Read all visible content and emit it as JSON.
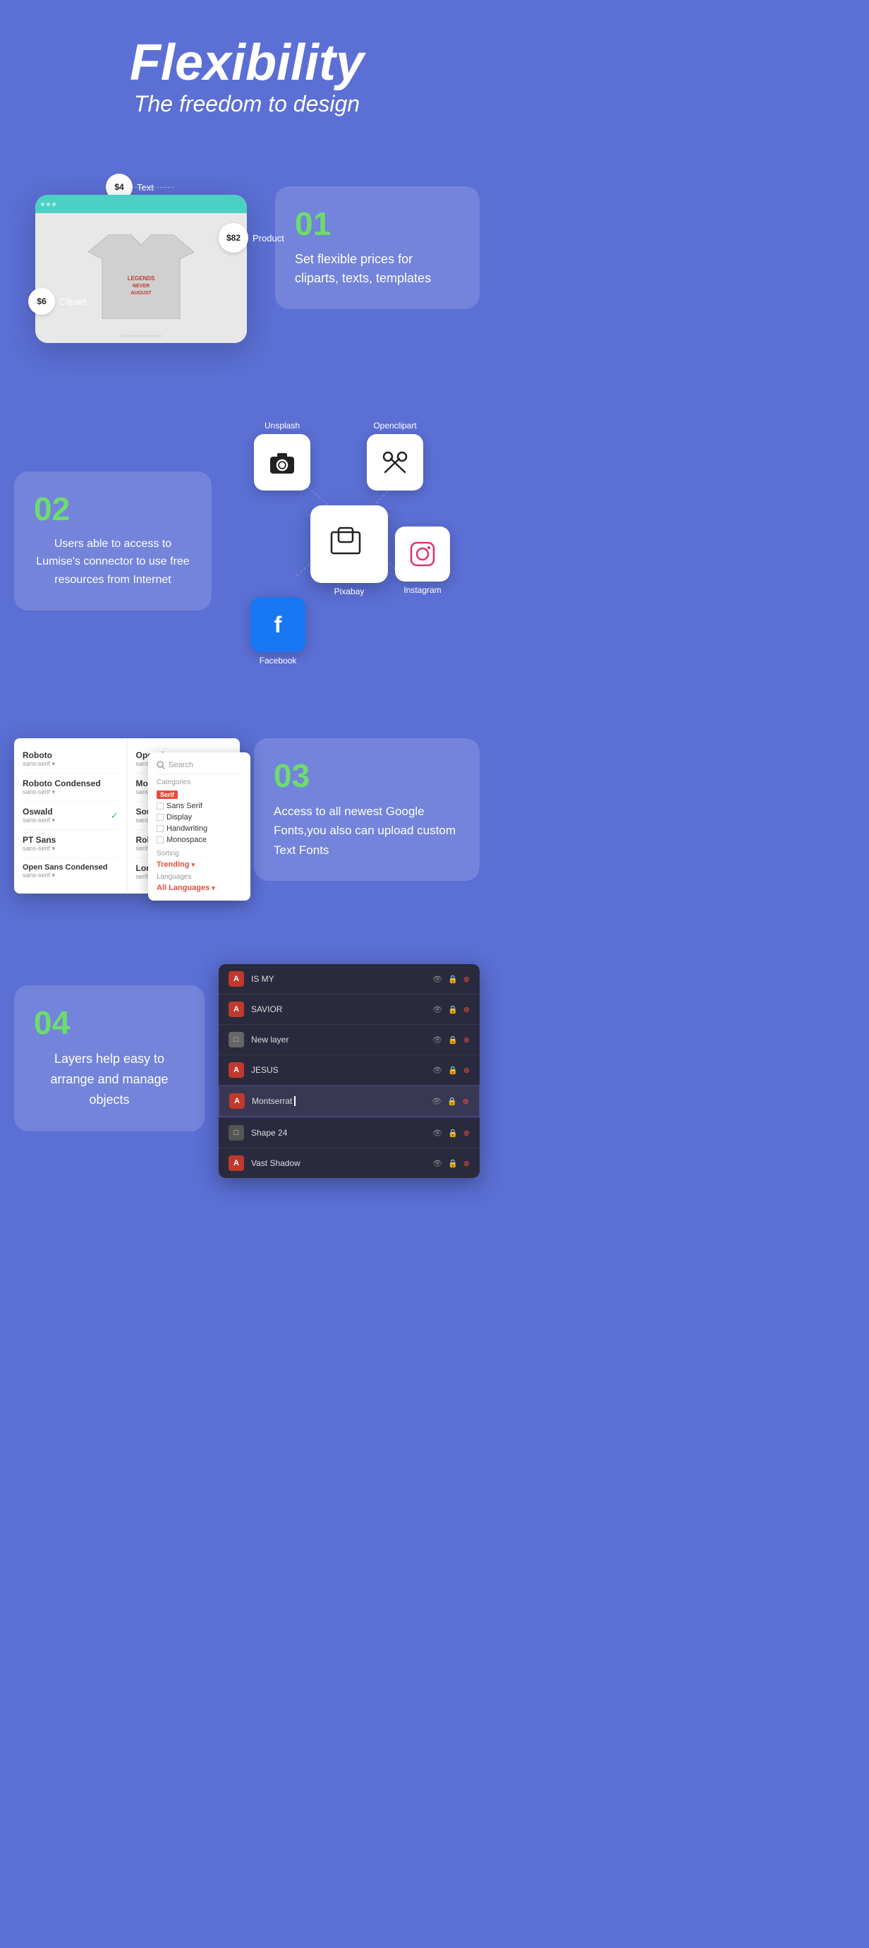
{
  "hero": {
    "title": "Flexibility",
    "subtitle": "The freedom to design"
  },
  "section1": {
    "number": "01",
    "description": "Set flexible prices for cliparts, texts, templates",
    "prices": {
      "text": "$4",
      "text_label": "Text",
      "product": "$82",
      "product_label": "Product",
      "clipart": "$6",
      "clipart_label": "Clipart"
    }
  },
  "section2": {
    "number": "02",
    "description": "Users able to access to Lumise's connector to use free resources from Internet",
    "connectors": [
      {
        "name": "Unsplash",
        "icon": "camera"
      },
      {
        "name": "Openclipart",
        "icon": "scissors"
      },
      {
        "name": "Pixabay",
        "icon": "photos"
      },
      {
        "name": "Instagram",
        "icon": "instagram"
      },
      {
        "name": "Facebook",
        "icon": "facebook"
      }
    ]
  },
  "section3": {
    "number": "03",
    "description": "Access to all newest Google Fonts,you also can upload custom Text Fonts",
    "fonts_left": [
      {
        "name": "Roboto",
        "meta": "sans-serif",
        "selected": false
      },
      {
        "name": "Roboto Condensed",
        "meta": "sans-serif",
        "selected": false
      },
      {
        "name": "Oswald",
        "meta": "sans-serif",
        "selected": true
      },
      {
        "name": "PT Sans",
        "meta": "sans-serif",
        "selected": false
      },
      {
        "name": "Open Sans Condensed",
        "meta": "sans-serif",
        "selected": false
      }
    ],
    "fonts_right": [
      {
        "name": "Open Sans",
        "meta": "sans-serif",
        "selected": true
      },
      {
        "name": "Montserrat",
        "meta": "sans-serif",
        "selected": false
      },
      {
        "name": "Source Sans",
        "meta": "sans-serif",
        "selected": false
      },
      {
        "name": "Roboto Slab",
        "meta": "serif",
        "selected": false
      },
      {
        "name": "Lora",
        "meta": "serif",
        "selected": false
      }
    ],
    "dropdown": {
      "search_placeholder": "Search",
      "categories_label": "Categories",
      "categories": [
        "Serif",
        "Sans Serif",
        "Display",
        "Handwriting",
        "Monospace"
      ],
      "sorting_label": "Sorting",
      "sorting_value": "Trending",
      "languages_label": "Languages",
      "languages_value": "All Languages"
    }
  },
  "section4": {
    "number": "04",
    "description": "Layers help easy to arrange and manage objects",
    "layers": [
      {
        "name": "IS MY",
        "icon": "text",
        "active": false
      },
      {
        "name": "SAVIOR",
        "icon": "text",
        "active": false
      },
      {
        "name": "New layer",
        "icon": "shape",
        "active": false
      },
      {
        "name": "JESUS",
        "icon": "text",
        "active": false
      },
      {
        "name": "Montserrat",
        "icon": "text",
        "active": true
      },
      {
        "name": "Shape 24",
        "icon": "shape",
        "active": false
      },
      {
        "name": "Vast Shadow",
        "icon": "text-red",
        "active": false
      }
    ]
  },
  "colors": {
    "background": "#5b6fd4",
    "accent_green": "#6ddc6d",
    "accent_red": "#e74c3c",
    "panel_bg": "#2a2a3e",
    "card_bg": "rgba(255,255,255,0.15)"
  }
}
